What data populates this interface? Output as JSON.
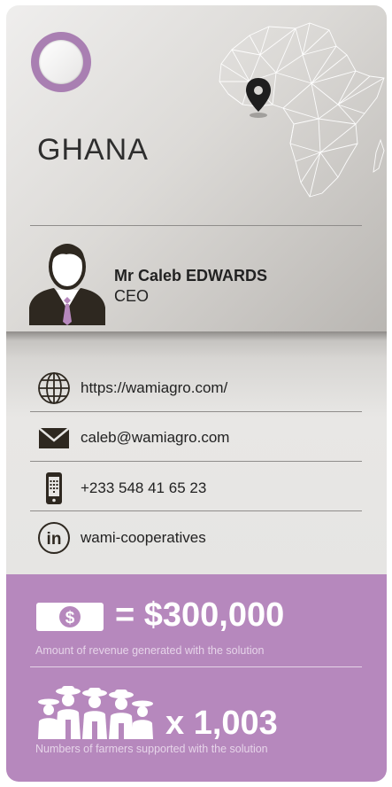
{
  "country": "GHANA",
  "contact_person": {
    "name": "Mr Caleb EDWARDS",
    "role": "CEO"
  },
  "contacts": [
    {
      "icon": "globe-icon",
      "text": "https://wamiagro.com/"
    },
    {
      "icon": "envelope-icon",
      "text": "caleb@wamiagro.com"
    },
    {
      "icon": "phone-icon",
      "text": "+233 548 41 65 23"
    },
    {
      "icon": "linkedin-icon",
      "text": "wami-cooperatives"
    }
  ],
  "stats": {
    "revenue": {
      "value": "= $300,000",
      "caption": "Amount of revenue generated with the solution",
      "icon": "money-icon"
    },
    "farmers": {
      "value": "x 1,003",
      "caption": "Numbers of farmers supported with the solution",
      "icon": "farmers-group-icon"
    }
  },
  "colors": {
    "accent": "#b688bd",
    "badge": "#a97fb2",
    "dark": "#2e2820",
    "map_pin": "#1e1e1e"
  }
}
